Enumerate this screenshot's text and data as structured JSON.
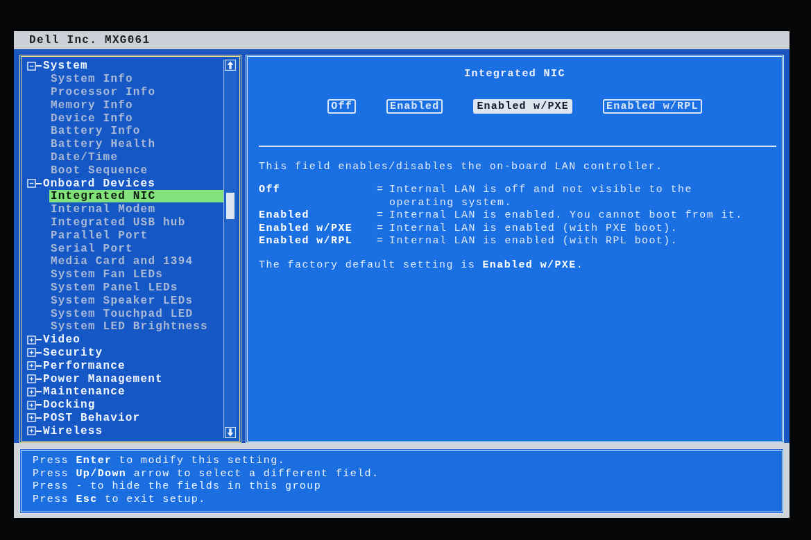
{
  "title_bar": {
    "title": "Dell Inc. MXG061"
  },
  "tree": [
    {
      "label": "System",
      "expanded": true,
      "children": [
        {
          "label": "System Info",
          "selected": false
        },
        {
          "label": "Processor Info",
          "selected": false
        },
        {
          "label": "Memory Info",
          "selected": false
        },
        {
          "label": "Device Info",
          "selected": false
        },
        {
          "label": "Battery Info",
          "selected": false
        },
        {
          "label": "Battery Health",
          "selected": false
        },
        {
          "label": "Date/Time",
          "selected": false
        },
        {
          "label": "Boot Sequence",
          "selected": false
        }
      ]
    },
    {
      "label": "Onboard Devices",
      "expanded": true,
      "children": [
        {
          "label": "Integrated NIC",
          "selected": true
        },
        {
          "label": "Internal Modem",
          "selected": false
        },
        {
          "label": "Integrated USB hub",
          "selected": false
        },
        {
          "label": "Parallel Port",
          "selected": false
        },
        {
          "label": "Serial Port",
          "selected": false
        },
        {
          "label": "Media Card and 1394",
          "selected": false
        },
        {
          "label": "System Fan LEDs",
          "selected": false
        },
        {
          "label": "System Panel LEDs",
          "selected": false
        },
        {
          "label": "System Speaker LEDs",
          "selected": false
        },
        {
          "label": "System Touchpad LED",
          "selected": false
        },
        {
          "label": "System LED Brightness",
          "selected": false
        }
      ]
    },
    {
      "label": "Video",
      "expanded": false
    },
    {
      "label": "Security",
      "expanded": false
    },
    {
      "label": "Performance",
      "expanded": false
    },
    {
      "label": "Power Management",
      "expanded": false
    },
    {
      "label": "Maintenance",
      "expanded": false
    },
    {
      "label": "Docking",
      "expanded": false
    },
    {
      "label": "POST Behavior",
      "expanded": false
    },
    {
      "label": "Wireless",
      "expanded": false
    }
  ],
  "setting": {
    "title": "Integrated NIC",
    "options": [
      {
        "label": "Off",
        "selected": false
      },
      {
        "label": "Enabled",
        "selected": false
      },
      {
        "label": "Enabled w/PXE",
        "selected": true
      },
      {
        "label": "Enabled w/RPL",
        "selected": false
      }
    ],
    "intro": "This field enables/disables the on-board LAN controller.",
    "definitions": [
      {
        "term": "Off",
        "sep": "=",
        "lines": [
          "Internal LAN is off and not visible to the",
          "operating system."
        ]
      },
      {
        "term": "Enabled",
        "sep": "=",
        "lines": [
          "Internal LAN is enabled. You cannot boot from it."
        ]
      },
      {
        "term": "Enabled w/PXE",
        "sep": "=",
        "lines": [
          "Internal LAN is enabled (with PXE boot)."
        ]
      },
      {
        "term": "Enabled w/RPL",
        "sep": "=",
        "lines": [
          "Internal LAN is enabled (with RPL boot)."
        ]
      }
    ],
    "default_note": "The factory default setting is **Enabled w/PXE**."
  },
  "help": [
    "Press **Enter** to modify this setting.",
    "Press **Up/Down** arrow to select a different field.",
    "Press - to hide the fields in this group",
    "Press **Esc** to exit setup."
  ]
}
